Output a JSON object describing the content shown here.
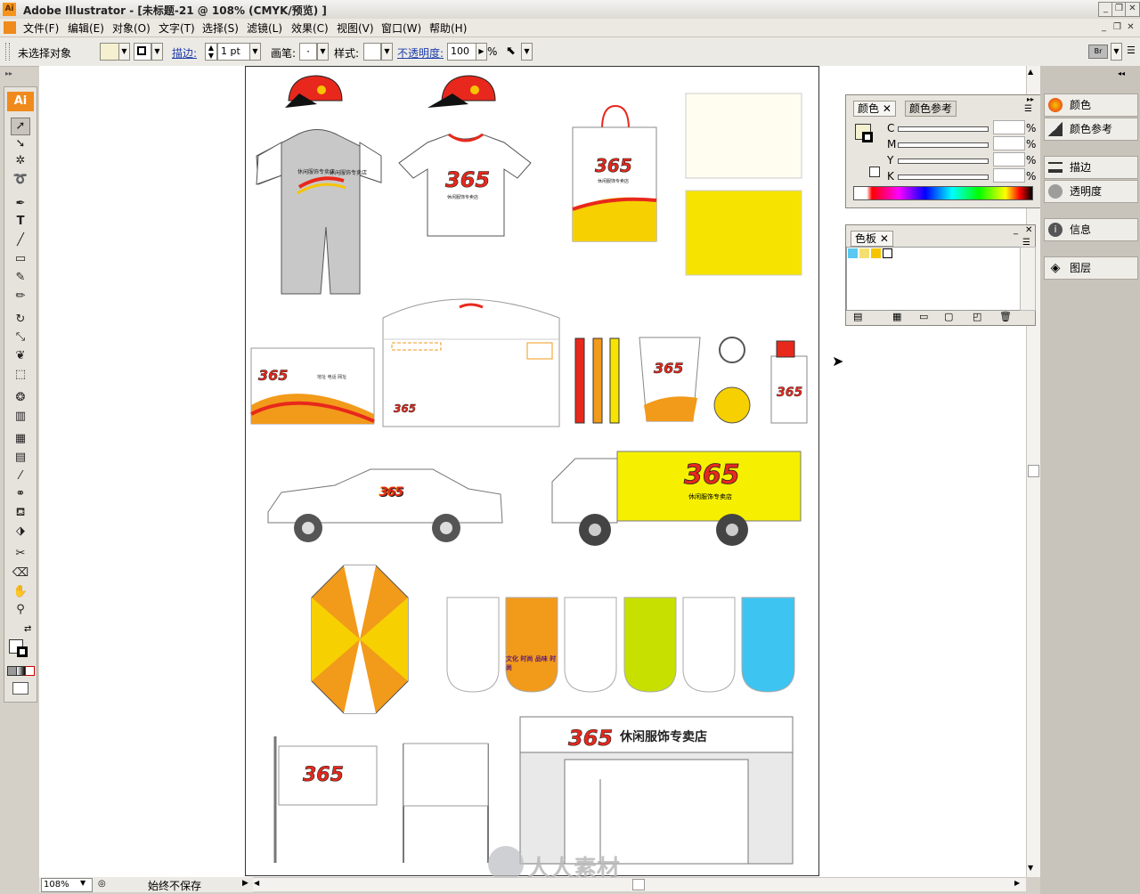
{
  "window": {
    "title": "Adobe Illustrator - [未标题-21 @ 108% (CMYK/预览) ]",
    "app_icon": "Ai",
    "controls": [
      "minimize-icon",
      "restore-icon",
      "close-icon"
    ]
  },
  "menu": {
    "items": [
      "文件(F)",
      "编辑(E)",
      "对象(O)",
      "文字(T)",
      "选择(S)",
      "滤镜(L)",
      "效果(C)",
      "视图(V)",
      "窗口(W)",
      "帮助(H)"
    ]
  },
  "control_bar": {
    "selection_status": "未选择对象",
    "stroke_label": "描边:",
    "stroke_weight": "1 pt",
    "brush_label": "画笔:",
    "brush_value": "·",
    "style_label": "样式:",
    "opacity_label": "不透明度:",
    "opacity_value": "100",
    "opacity_unit": "%"
  },
  "toolbox": {
    "logo": "Ai",
    "tools": [
      "selection-tool",
      "direct-selection-tool",
      "magic-wand-tool",
      "lasso-tool",
      "pen-tool",
      "type-tool",
      "line-tool",
      "rectangle-tool",
      "paintbrush-tool",
      "pencil-tool",
      "rotate-tool",
      "scale-tool",
      "warp-tool",
      "free-transform-tool",
      "symbol-sprayer-tool",
      "graph-tool",
      "mesh-tool",
      "gradient-tool",
      "eyedropper-tool",
      "blend-tool",
      "live-paint-tool",
      "live-paint-selection-tool",
      "slice-tool",
      "eraser-tool",
      "hand-tool",
      "zoom-tool"
    ]
  },
  "color_panel": {
    "tabs": [
      "颜色",
      "颜色参考"
    ],
    "channels": [
      "C",
      "M",
      "Y",
      "K"
    ],
    "unit": "%"
  },
  "swatches_panel": {
    "tabs": [
      "色板"
    ]
  },
  "dock": {
    "items": [
      {
        "label": "颜色",
        "icon": "color-icon"
      },
      {
        "label": "颜色参考",
        "icon": "color-guide-icon"
      },
      {
        "label": "描边",
        "icon": "stroke-icon"
      },
      {
        "label": "透明度",
        "icon": "transparency-icon"
      },
      {
        "label": "信息",
        "icon": "info-icon"
      },
      {
        "label": "图层",
        "icon": "layers-icon"
      }
    ]
  },
  "status": {
    "zoom": "108%",
    "save_state": "始终不保存"
  },
  "artwork": {
    "logo_text": "365",
    "shop_name": "休闲服饰专卖店",
    "banner_slogan": "文化 时尚 品味 时尚",
    "watermark": "人人素材"
  },
  "colors": {
    "brand_red": "#e8281c",
    "brand_yellow": "#f6e400",
    "brand_orange": "#f29a1a",
    "ui_gray": "#d4d0c8"
  }
}
